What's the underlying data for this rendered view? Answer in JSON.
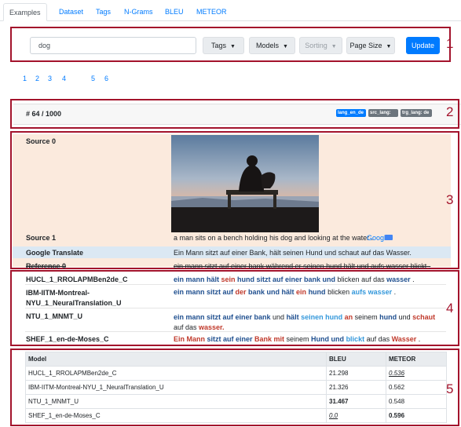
{
  "tabs": [
    "Examples",
    "Dataset",
    "Tags",
    "N-Grams",
    "BLEU",
    "METEOR"
  ],
  "search": {
    "value": "dog"
  },
  "buttons": {
    "tags": "Tags",
    "models": "Models",
    "sorting": "Sorting",
    "page_size": "Page Size",
    "update": "Update"
  },
  "pagination": [
    "1",
    "2",
    "3",
    "4",
    "5",
    "6"
  ],
  "example": {
    "number": "# 64 / 1000",
    "badges": [
      "lang_en_de",
      "src_lang: en",
      "trg_lang: de"
    ]
  },
  "section_numbers": [
    "1",
    "2",
    "3",
    "4",
    "5"
  ],
  "source": {
    "source0_label": "Source 0",
    "source1_label": "Source 1",
    "source1_text": "a man sits on a bench holding his dog and looking at the water .",
    "google_link": "Google",
    "google_label": "Google Translate",
    "google_text": "Ein Mann sitzt auf einer Bank, hält seinen Hund und schaut auf das Wasser.",
    "reference_label": "Reference 0",
    "reference_text": "ein mann sitzt auf einer bank während er seinen hund hält und aufs wasser blickt ."
  },
  "systems": [
    {
      "name": "HUCL_1_RROLAPMBen2de_C",
      "tokens": [
        [
          "ein mann hält ",
          "b"
        ],
        [
          "sein",
          "r"
        ],
        [
          " hund sitzt auf einer bank und ",
          "b"
        ],
        [
          "blicken auf das ",
          "n"
        ],
        [
          "wasser",
          "b"
        ],
        [
          " .",
          "n"
        ]
      ]
    },
    {
      "name": "IBM-IITM-Montreal-NYU_1_NeuralTranslation_U",
      "tokens": [
        [
          "ein mann sitzt auf ",
          "b"
        ],
        [
          "der",
          "r"
        ],
        [
          " bank und hält ",
          "b"
        ],
        [
          "ein",
          "r"
        ],
        [
          " hund ",
          "b"
        ],
        [
          "blicken ",
          "n"
        ],
        [
          "aufs wasser",
          "lb"
        ],
        [
          " .",
          "n"
        ]
      ]
    },
    {
      "name": "NTU_1_MNMT_U",
      "tokens": [
        [
          "ein mann sitzt auf einer bank ",
          "b"
        ],
        [
          "und ",
          "n"
        ],
        [
          "hält ",
          "b"
        ],
        [
          "seinen hund ",
          "lb"
        ],
        [
          "an",
          "r"
        ],
        [
          " seinem ",
          "n"
        ],
        [
          "hund",
          "b"
        ],
        [
          " und ",
          "n"
        ],
        [
          "schaut",
          "r"
        ],
        [
          " auf das ",
          "n"
        ],
        [
          "wasser.",
          "r"
        ]
      ]
    },
    {
      "name": "SHEF_1_en-de-Moses_C",
      "tokens": [
        [
          "Ein Mann",
          "r"
        ],
        [
          " sitzt auf einer ",
          "b"
        ],
        [
          "Bank mit",
          "r"
        ],
        [
          " seinem ",
          "n"
        ],
        [
          "Hund und",
          "b"
        ],
        [
          " ",
          "n"
        ],
        [
          "blickt",
          "lb"
        ],
        [
          " auf das ",
          "n"
        ],
        [
          "Wasser",
          "r"
        ],
        [
          " .",
          "n"
        ]
      ]
    }
  ],
  "table": {
    "headers": [
      "Model",
      "BLEU",
      "METEOR"
    ],
    "rows": [
      [
        "HUCL_1_RROLAPMBen2de_C",
        "21.298",
        "0.536"
      ],
      [
        "IBM-IITM-Montreal-NYU_1_NeuralTranslation_U",
        "21.326",
        "0.562"
      ],
      [
        "NTU_1_MNMT_U",
        "31.467",
        "0.548"
      ],
      [
        "SHEF_1_en-de-Moses_C",
        "0.0",
        "0.596"
      ]
    ]
  },
  "colors": {
    "accent": "#007bff",
    "annotation": "#a3132c",
    "source_bg": "#fbeadd",
    "google_bg": "#dbe8f3"
  }
}
